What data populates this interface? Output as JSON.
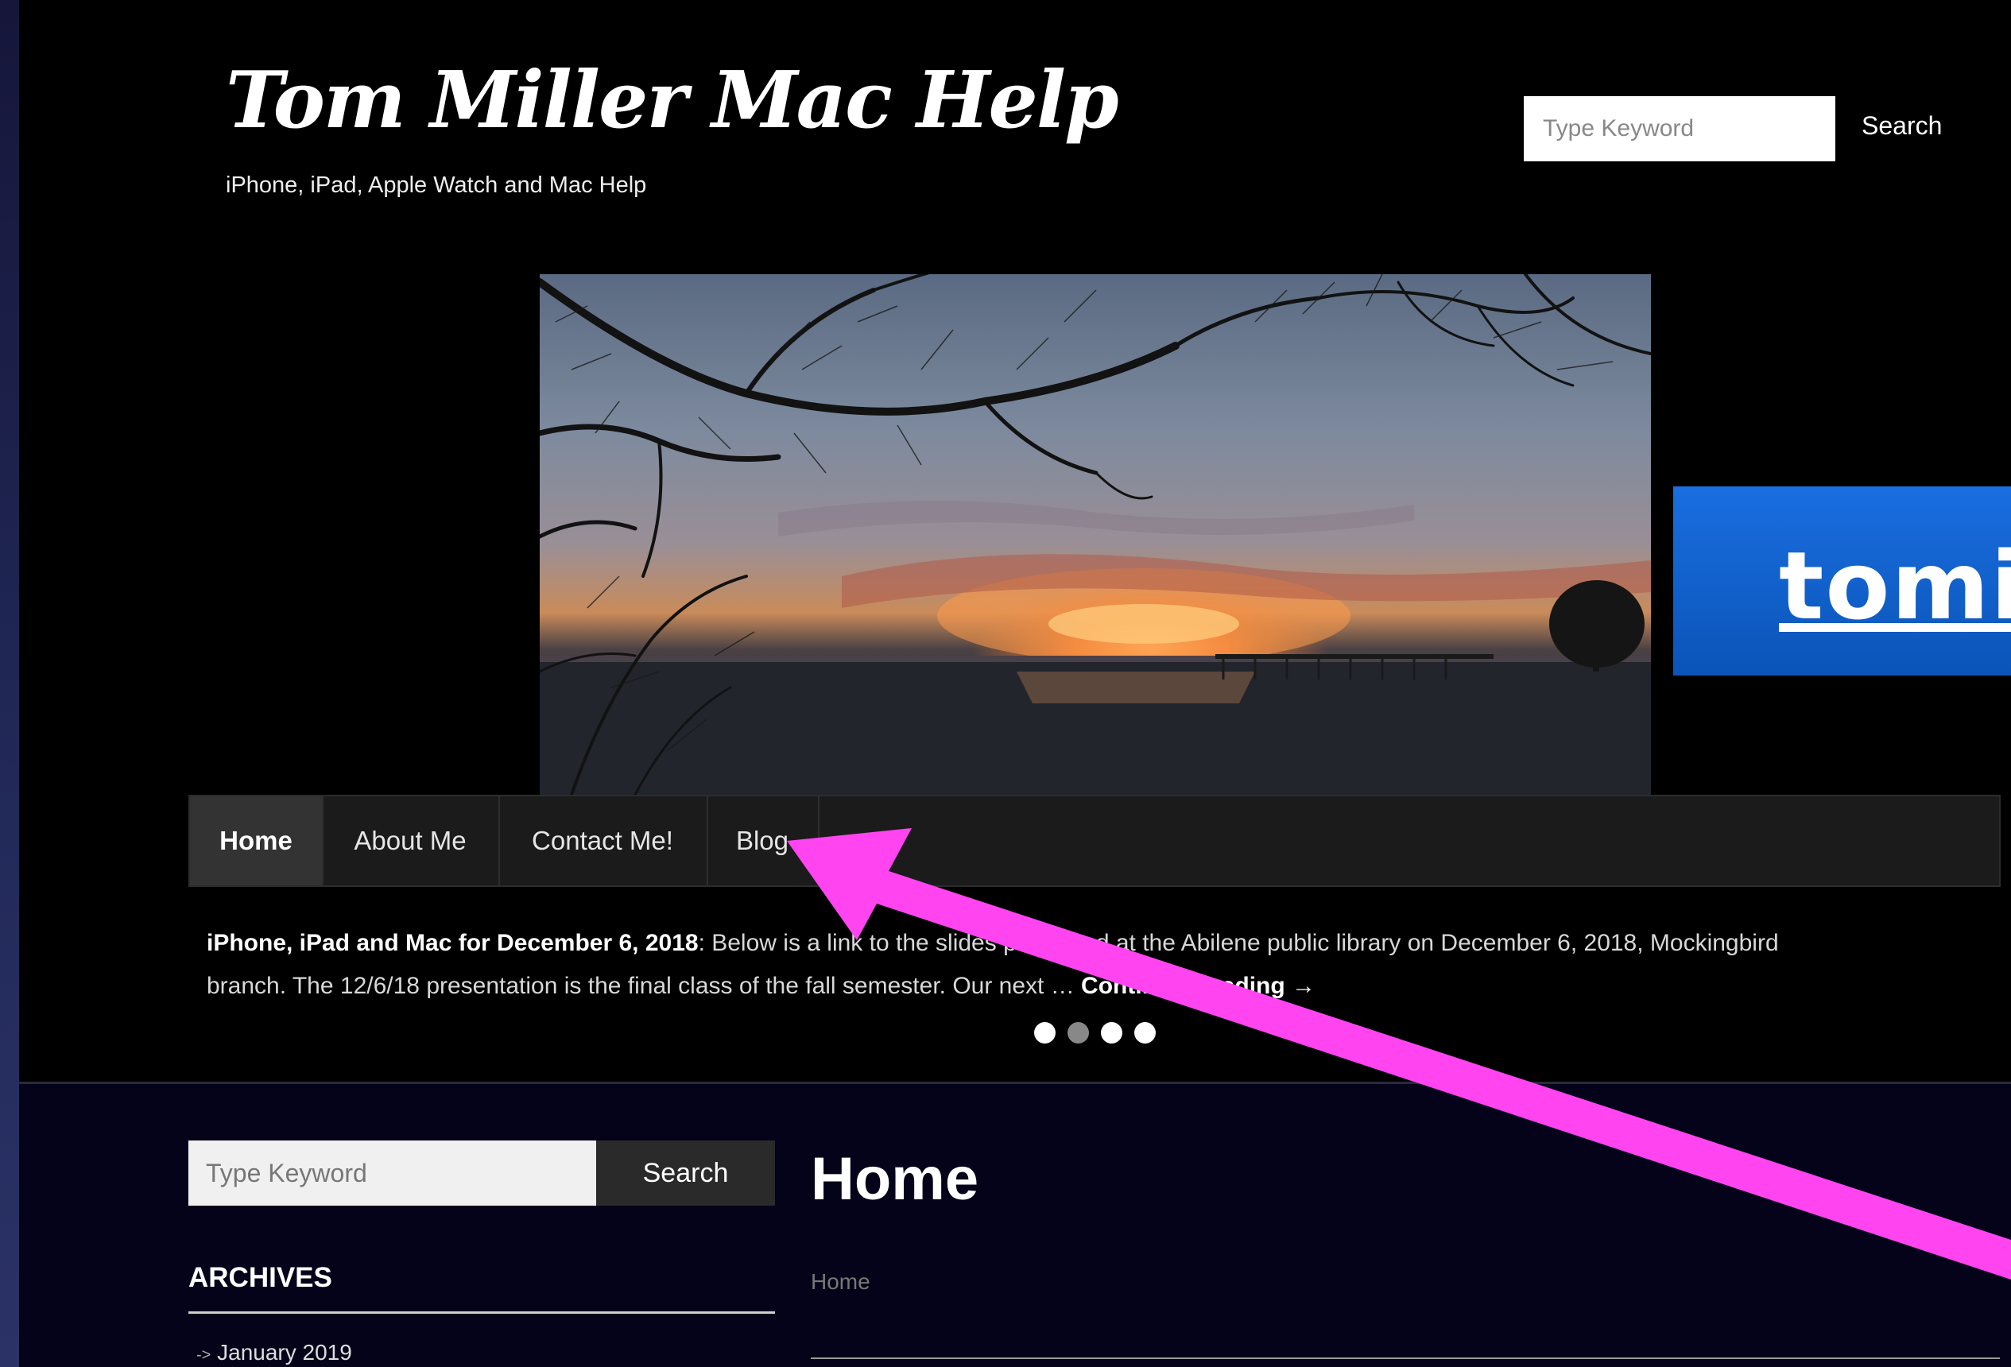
{
  "header": {
    "site_title": "Tom Miller Mac Help",
    "tagline": "iPhone, iPad, Apple Watch and Mac Help",
    "search_placeholder": "Type Keyword",
    "search_button": "Search"
  },
  "banner": {
    "text": "tomi"
  },
  "nav": {
    "items": [
      {
        "label": "Home"
      },
      {
        "label": "About Me"
      },
      {
        "label": "Contact Me!"
      },
      {
        "label": "Blog"
      }
    ]
  },
  "slider": {
    "post_title": "iPhone, iPad and Mac for December 6, 2018",
    "line1_rest": ":  Below is a link to the slides presented at the Abilene public library on December 6, 2018, Mockingbird",
    "line2": "branch.   The 12/6/18 presentation is the final class of the fall semester.  Our next … ",
    "read_more": "Continue Reading →",
    "dots_total": 4,
    "active_dot": 2
  },
  "sidebar": {
    "search_placeholder": "Type Keyword",
    "search_button": "Search",
    "archives_title": "ARCHIVES",
    "archive_items": [
      "January 2019"
    ],
    "archive_prefix": "->"
  },
  "main": {
    "title": "Home",
    "breadcrumb": "Home"
  },
  "colors": {
    "background": "#000000",
    "lower_background": "#05031a",
    "nav_background": "#1b1b1b",
    "banner_blue": "#1a6ee0",
    "arrow_magenta": "#ff44f0"
  }
}
